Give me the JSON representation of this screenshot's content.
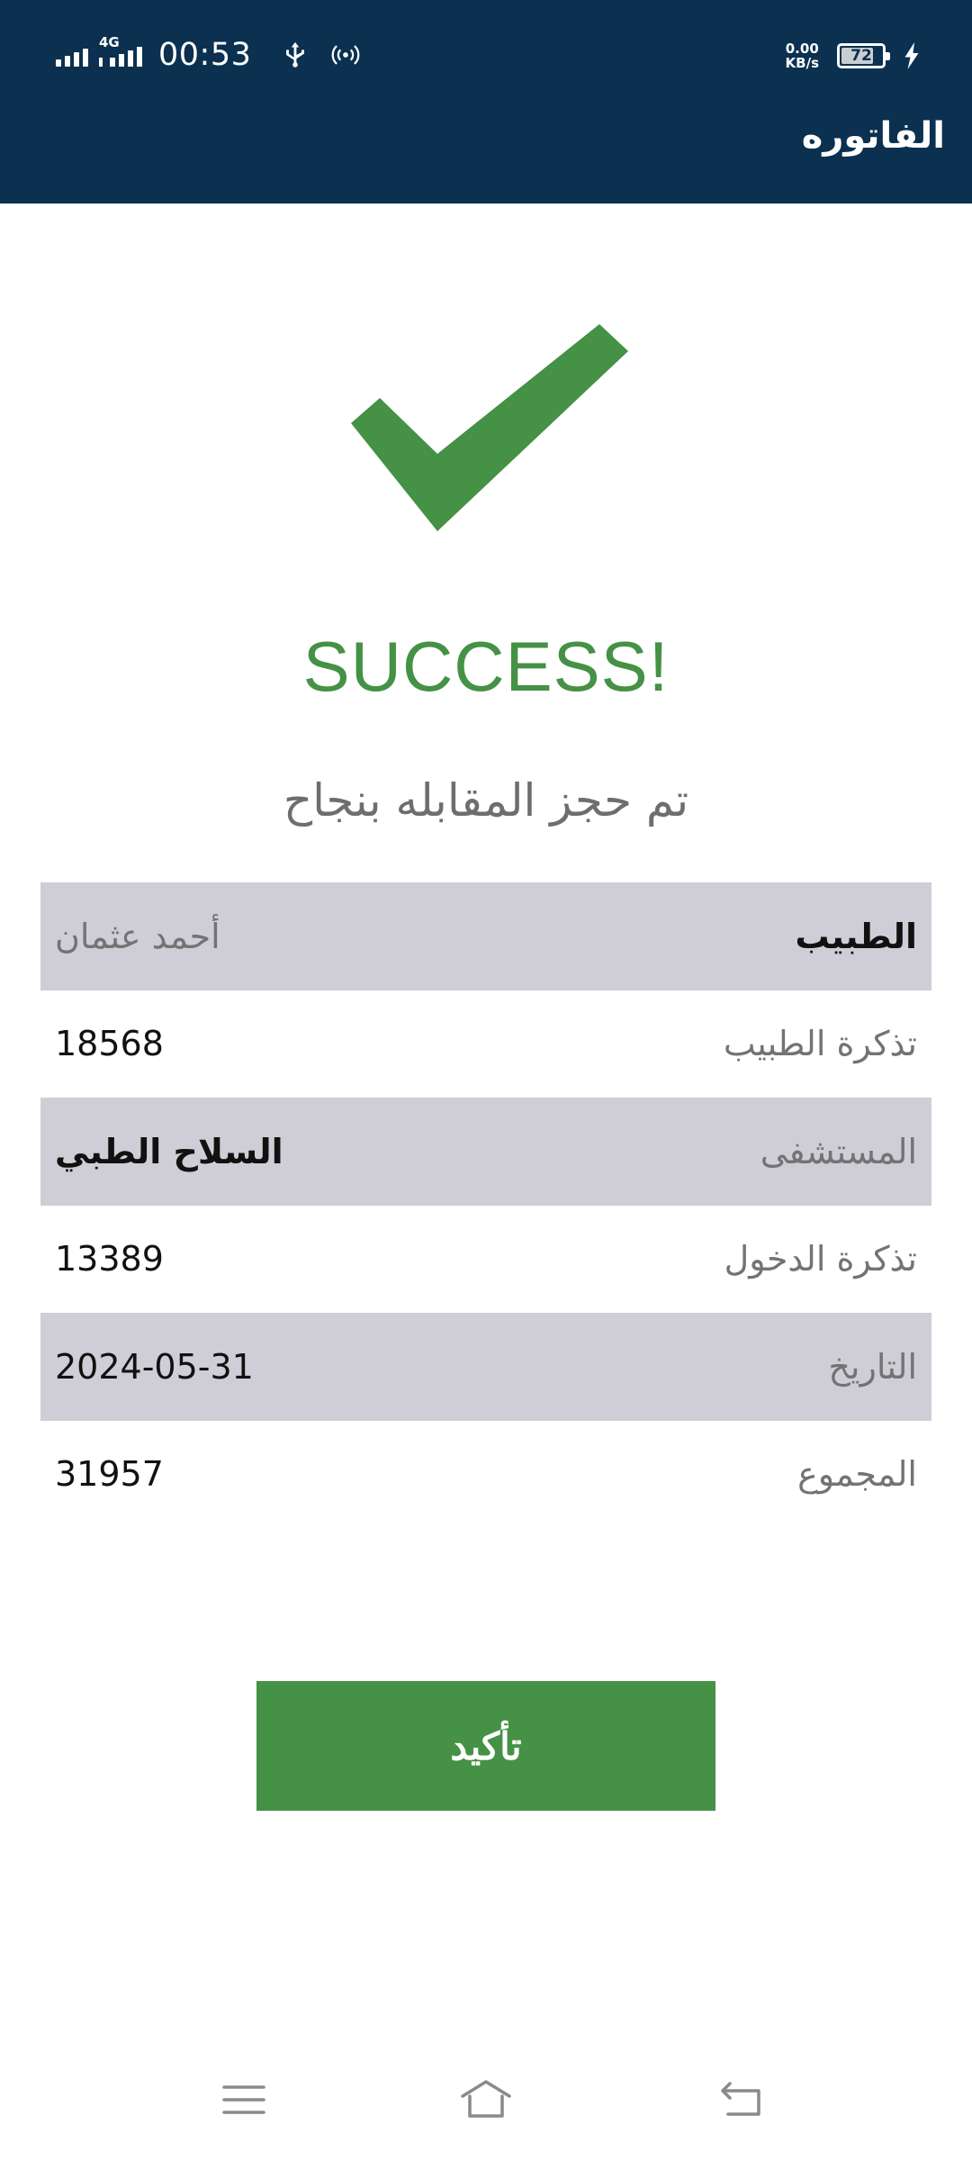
{
  "status_bar": {
    "network_type": "4G",
    "time": "00:53",
    "speed_value": "0.00",
    "speed_unit": "KB/s",
    "battery_level": "72",
    "icons": [
      "signal-icon",
      "usb-icon",
      "hotspot-icon",
      "battery-icon",
      "charging-bolt-icon"
    ]
  },
  "header": {
    "title": "الفاتوره"
  },
  "success": {
    "icon": "checkmark-icon",
    "title": "SUCCESS!",
    "message": "تم حجز المقابله بنجاح",
    "accent_color": "#459145"
  },
  "details": {
    "rows": [
      {
        "label": "الطبيب",
        "value": "أحمد عثمان"
      },
      {
        "label": "تذكرة  الطبيب",
        "value": "18568"
      },
      {
        "label": "المستشفى",
        "value": "السلاح الطبي"
      },
      {
        "label": "تذكرة الدخول",
        "value": "13389"
      },
      {
        "label": "التاريخ",
        "value": "2024-05-31"
      },
      {
        "label": "المجموع",
        "value": "31957"
      }
    ]
  },
  "actions": {
    "confirm_label": "تأكيد"
  },
  "nav": {
    "icons": [
      "menu-icon",
      "home-icon",
      "back-icon"
    ]
  },
  "colors": {
    "header_bg": "#0b3050",
    "row_shade": "#cfced6",
    "button_bg": "#459145"
  }
}
